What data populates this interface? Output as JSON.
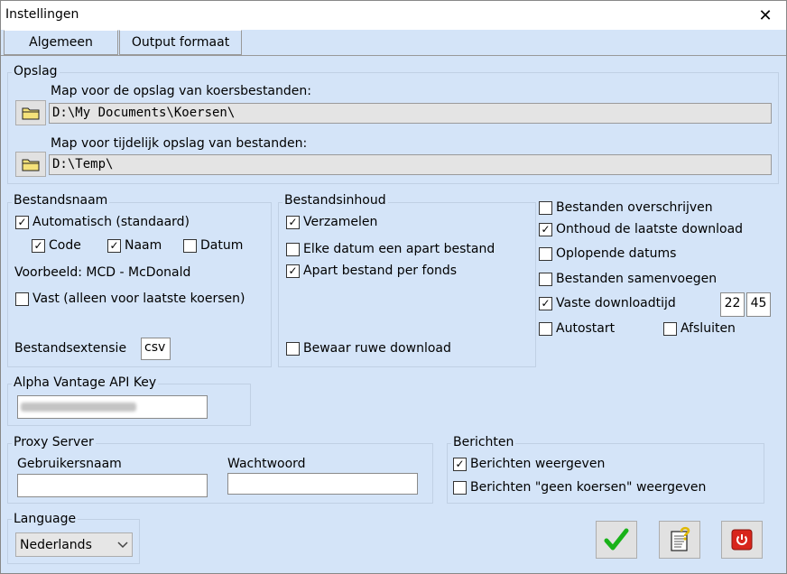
{
  "window": {
    "title": "Instellingen",
    "close_glyph": "✕"
  },
  "tabs": [
    {
      "label": "Algemeen"
    },
    {
      "label": "Output formaat"
    }
  ],
  "opslag": {
    "label": "Opslag",
    "koers_label": "Map voor de opslag van koersbestanden:",
    "koers_path": "D:\\My Documents\\Koersen\\",
    "temp_label": "Map voor tijdelijk opslag van bestanden:",
    "temp_path": "D:\\Temp\\"
  },
  "bestandsnaam": {
    "label": "Bestandsnaam",
    "automatisch": "Automatisch (standaard)",
    "code": "Code",
    "naam": "Naam",
    "datum": "Datum",
    "voorbeeld": "Voorbeeld: MCD - McDonald",
    "vast": "Vast (alleen voor laatste koersen)",
    "ext_label": "Bestandsextensie",
    "ext_value": "csv"
  },
  "bestandsinhoud": {
    "label": "Bestandsinhoud",
    "verzamelen": "Verzamelen",
    "elke_datum": "Elke datum een apart bestand",
    "apart_fonds": "Apart bestand per fonds",
    "bewaar": "Bewaar ruwe download"
  },
  "opties": {
    "overschrijven": "Bestanden overschrijven",
    "onthoud": "Onthoud de laatste download",
    "oplopend": "Oplopende datums",
    "samenvoegen": "Bestanden samenvoegen",
    "vaste_tijd": "Vaste downloadtijd",
    "uur": "22",
    "minuut": "45",
    "autostart": "Autostart",
    "afsluiten": "Afsluiten"
  },
  "api": {
    "label": "Alpha Vantage API Key"
  },
  "proxy": {
    "label": "Proxy Server",
    "user_label": "Gebruikersnaam",
    "pass_label": "Wachtwoord"
  },
  "berichten": {
    "label": "Berichten",
    "weergeven": "Berichten weergeven",
    "geen_koersen": "Berichten \"geen koersen\" weergeven"
  },
  "language": {
    "label": "Language",
    "value": "Nederlands"
  },
  "check_glyph": "✓",
  "colors": {
    "ok_green": "#19b219",
    "power_red": "#d8251c"
  }
}
